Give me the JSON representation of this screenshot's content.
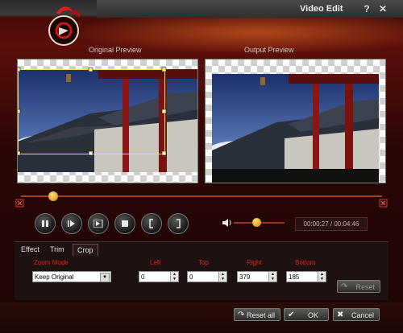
{
  "window": {
    "title": "Video Edit",
    "help_symbol": "?",
    "close_symbol": "✕"
  },
  "preview": {
    "original_label": "Original Preview",
    "output_label": "Output Preview"
  },
  "playback": {
    "time_display": "00:00:27 / 00:04:46",
    "progress": 0.09,
    "volume": 0.45
  },
  "tabs": [
    {
      "label": "Effect"
    },
    {
      "label": "Trim"
    },
    {
      "label": "Crop"
    }
  ],
  "crop": {
    "zoom_mode_label": "Zoom Mode",
    "zoom_mode_value": "Keep Original",
    "left_label": "Left",
    "left_value": "0",
    "top_label": "Top",
    "top_value": "0",
    "right_label": "Right",
    "right_value": "379",
    "bottom_label": "Bottom",
    "bottom_value": "185",
    "reset_label": "Reset"
  },
  "footer": {
    "reset_all_label": "Reset all",
    "ok_label": "OK",
    "cancel_label": "Cancel"
  },
  "icons": {
    "play_pause": "pause-icon",
    "play": "play-icon",
    "frame_step": "frame-step-icon",
    "stop": "stop-icon",
    "mark_in": "bracket-left-icon",
    "mark_out": "bracket-right-icon",
    "volume": "speaker-icon"
  },
  "colors": {
    "accent_red": "#e02020",
    "window_bg": "#3a0a08",
    "slider_knob": "#f0a020"
  }
}
